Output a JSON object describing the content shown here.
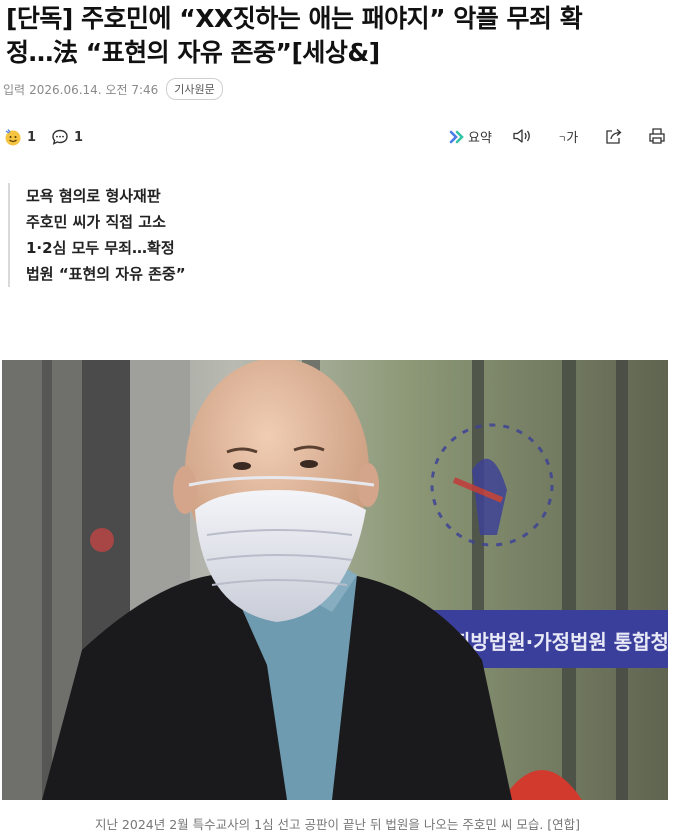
{
  "article": {
    "headline_line1": "[단독] 주호민에 “XX짓하는 애는 패야지” 악플 무죄 확",
    "headline_line2": "정…法 “표현의 자유 존중”[세상&]",
    "meta_label": "입력",
    "date": "2026.06.14. 오전 7:46",
    "origin_button": "기사원문"
  },
  "toolbar": {
    "reaction_count": "1",
    "comment_count": "1",
    "summary_label": "요약",
    "font_size_label": "가",
    "icons": [
      "reaction-emoji-icon",
      "comment-icon",
      "summary-icon",
      "audio-icon",
      "font-size-icon",
      "share-icon",
      "print-icon"
    ]
  },
  "summary": [
    "모욕 혐의로 형사재판",
    "주호민 씨가 직접 고소",
    "1·2심 모두 무죄…확정",
    "법원 “표현의 자유 존중”"
  ],
  "photo": {
    "sign_text": "지방법원·가정법원 통합청사",
    "caption": "지난 2024년 2월 특수교사의 1심 선고 공판이 끝난 뒤 법원을 나오는 주호민 씨 모습. [연합]"
  },
  "colors": {
    "accent_summary": "#4a7ce8",
    "sign_blue": "#3b3f9c"
  }
}
